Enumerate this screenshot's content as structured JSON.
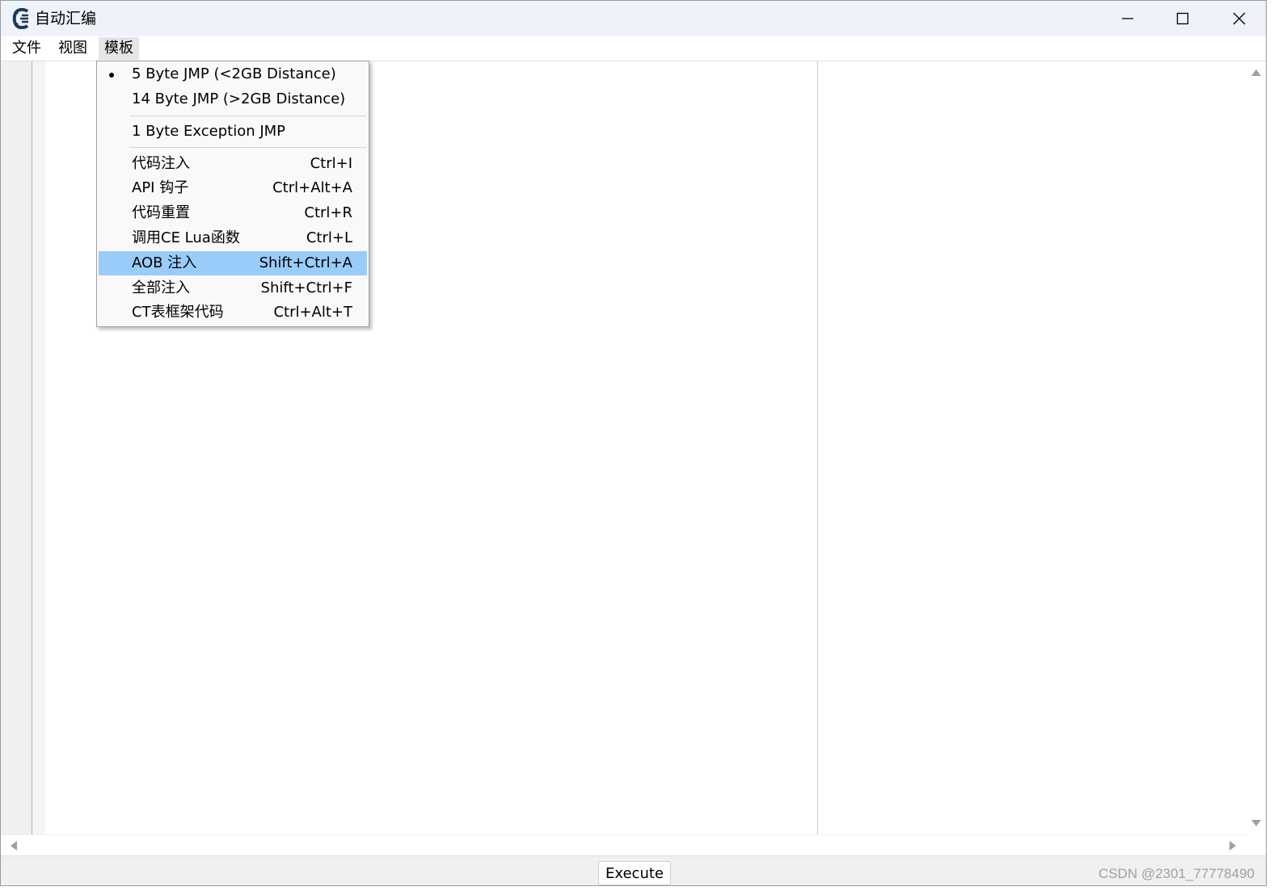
{
  "window": {
    "title": "自动汇编"
  },
  "menubar": {
    "items": [
      "文件",
      "视图",
      "模板"
    ]
  },
  "template_menu": {
    "groups": [
      [
        {
          "label": "5 Byte JMP (<2GB Distance)",
          "shortcut": "",
          "checked": true
        },
        {
          "label": "14 Byte JMP (>2GB Distance)",
          "shortcut": "",
          "checked": false
        }
      ],
      [
        {
          "label": "1 Byte Exception JMP",
          "shortcut": "",
          "checked": false
        }
      ],
      [
        {
          "label": "代码注入",
          "shortcut": "Ctrl+I"
        },
        {
          "label": "API 钩子",
          "shortcut": "Ctrl+Alt+A"
        },
        {
          "label": "代码重置",
          "shortcut": "Ctrl+R"
        },
        {
          "label": "调用CE Lua函数",
          "shortcut": "Ctrl+L"
        },
        {
          "label": "AOB 注入",
          "shortcut": "Shift+Ctrl+A",
          "highlighted": true
        },
        {
          "label": "全部注入",
          "shortcut": "Shift+Ctrl+F"
        },
        {
          "label": "CT表框架代码",
          "shortcut": "Ctrl+Alt+T"
        }
      ]
    ]
  },
  "footer": {
    "execute_label": "Execute",
    "watermark": "CSDN @2301_77778490"
  },
  "colors": {
    "highlight": "#99ccf9",
    "titlebar": "#eef2f9"
  }
}
